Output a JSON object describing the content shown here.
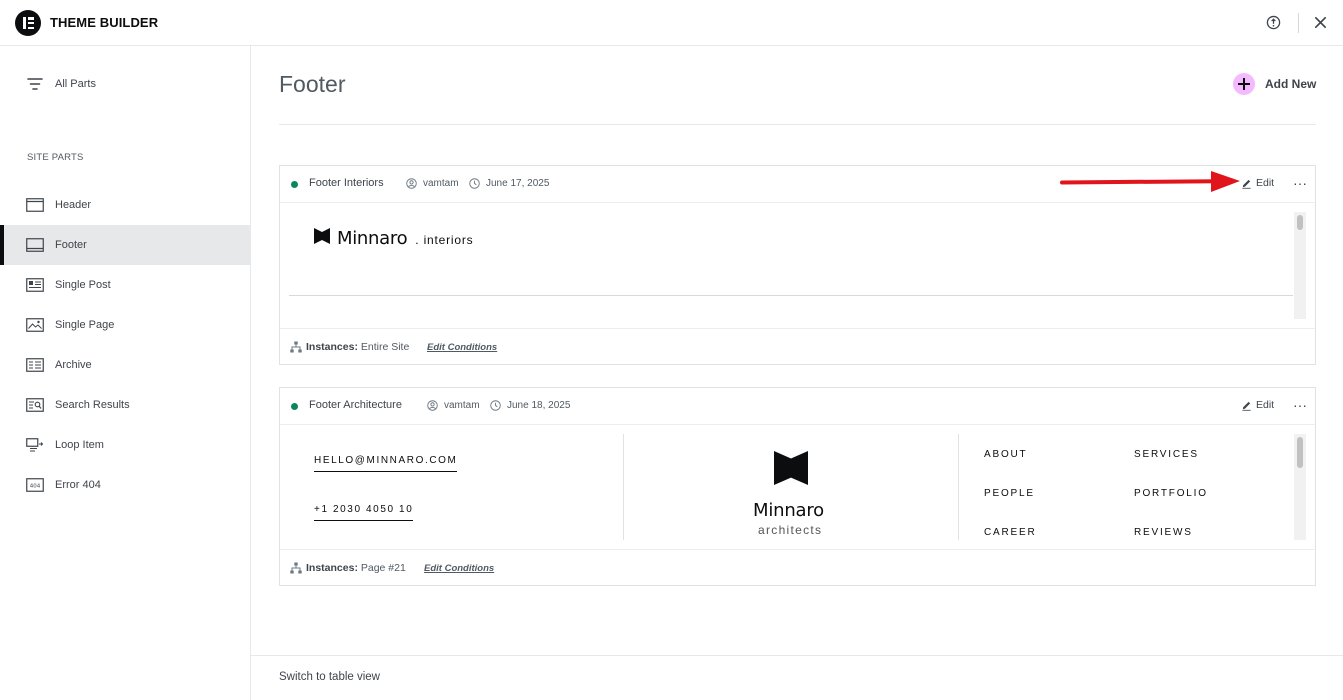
{
  "app": {
    "title": "THEME BUILDER"
  },
  "sidebar": {
    "all_parts_label": "All Parts",
    "section_label": "SITE PARTS",
    "items": [
      {
        "label": "Header",
        "icon": "header-icon"
      },
      {
        "label": "Footer",
        "icon": "footer-icon",
        "active": true
      },
      {
        "label": "Single Post",
        "icon": "single-post-icon"
      },
      {
        "label": "Single Page",
        "icon": "single-page-icon"
      },
      {
        "label": "Archive",
        "icon": "archive-icon"
      },
      {
        "label": "Search Results",
        "icon": "search-results-icon"
      },
      {
        "label": "Loop Item",
        "icon": "loop-item-icon"
      },
      {
        "label": "Error 404",
        "icon": "error-404-icon"
      }
    ]
  },
  "main": {
    "title": "Footer",
    "add_new_label": "Add New",
    "cards": [
      {
        "title": "Footer Interiors",
        "author": "vamtam",
        "date": "June 17, 2025",
        "status_color": "#0a875a",
        "edit_label": "Edit",
        "more_label": "···",
        "instances_label": "Instances:",
        "instances_value": "Entire Site",
        "edit_conditions_label": "Edit Conditions",
        "preview": {
          "brand_name": "Minnaro",
          "brand_sub": ". interiors"
        }
      },
      {
        "title": "Footer Architecture",
        "author": "vamtam",
        "date": "June 18, 2025",
        "status_color": "#0a875a",
        "edit_label": "Edit",
        "more_label": "···",
        "instances_label": "Instances:",
        "instances_value": "Page #21",
        "edit_conditions_label": "Edit Conditions",
        "preview": {
          "email": "HELLO@MINNARO.COM",
          "phone": "+1 2030 4050 10",
          "brand_name": "Minnaro",
          "brand_sub": "architects",
          "links_col1": [
            "ABOUT",
            "PEOPLE",
            "CAREER"
          ],
          "links_col2": [
            "SERVICES",
            "PORTFOLIO",
            "REVIEWS"
          ]
        }
      }
    ]
  },
  "footer": {
    "table_view_label": "Switch to table view"
  },
  "colors": {
    "accent_plus": "#f3bafd",
    "annotation_arrow": "#e0141a",
    "status_green": "#0a875a"
  }
}
